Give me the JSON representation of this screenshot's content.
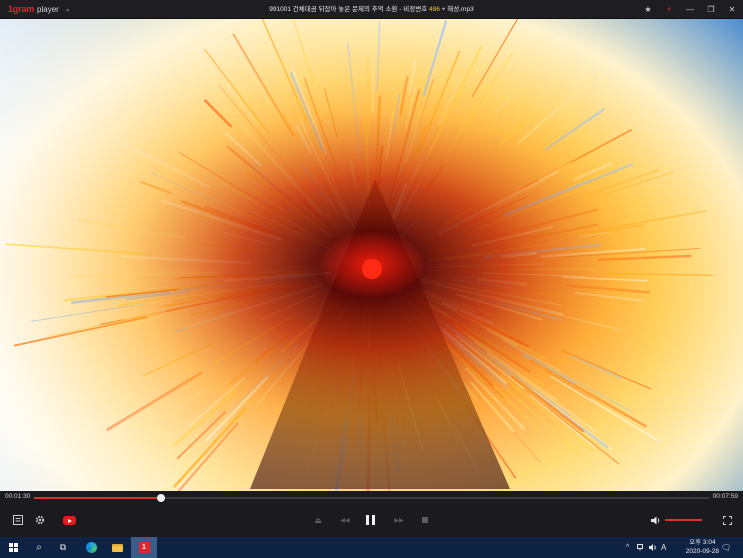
{
  "app": {
    "logo_mark": "1gram",
    "logo_text": "player",
    "menu_caret": "⌄"
  },
  "title": {
    "prefix": "991001 건체대곰 뒤잡아 놓은 문제의 추억 소환 - 비정변호 ",
    "highlight": "486",
    "suffix": " + 해성.mp3"
  },
  "window_controls": {
    "pin": "★",
    "record": "⚡",
    "minimize": "—",
    "restore": "❐",
    "close": "✕"
  },
  "playback": {
    "current_time": "00:01:30",
    "total_time": "00:07:59",
    "progress": 0.1879,
    "volume": 1.0
  },
  "controls": {
    "playlist_icon": "playlist-icon",
    "settings_icon": "gear-icon",
    "youtube_icon": "youtube-icon",
    "eject": "⏏",
    "prev": "◀◀",
    "next": "▶▶",
    "volume_icon": "🔈",
    "fullscreen": "⛶"
  },
  "taskbar": {
    "search": "⌕",
    "taskview": "⧉",
    "tray_chevron": "^",
    "tray_lang": "A",
    "clock_time": "오후 3:04",
    "clock_date": "2020-09-28",
    "notification": "🗨"
  }
}
